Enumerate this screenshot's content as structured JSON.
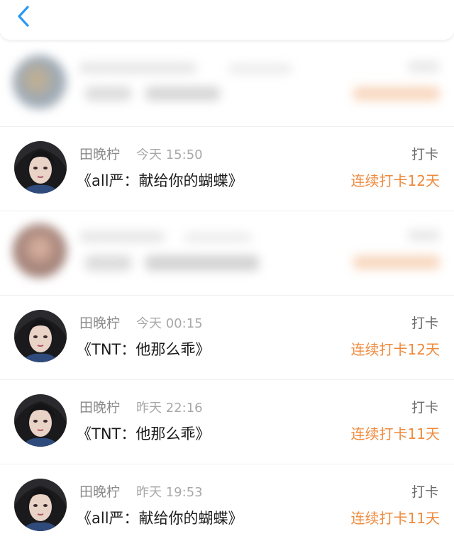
{
  "header": {
    "back_icon": "chevron-left-icon",
    "accent_color": "#2b9af3"
  },
  "colors": {
    "streak": "#ef8a3c",
    "name": "#8a8a8a",
    "time": "#a8a8a8"
  },
  "entries": [
    {
      "name": "田晚柠",
      "time": "今天 15:50",
      "title": "《all严：献给你的蝴蝶》",
      "tag": "打卡",
      "streak": "连续打卡12天"
    },
    {
      "name": "田晚柠",
      "time": "今天 00:15",
      "title": "《TNT：他那么乖》",
      "tag": "打卡",
      "streak": "连续打卡12天"
    },
    {
      "name": "田晚柠",
      "time": "昨天 22:16",
      "title": "《TNT：他那么乖》",
      "tag": "打卡",
      "streak": "连续打卡11天"
    },
    {
      "name": "田晚柠",
      "time": "昨天 19:53",
      "title": "《all严：献给你的蝴蝶》",
      "tag": "打卡",
      "streak": "连续打卡11天"
    }
  ]
}
